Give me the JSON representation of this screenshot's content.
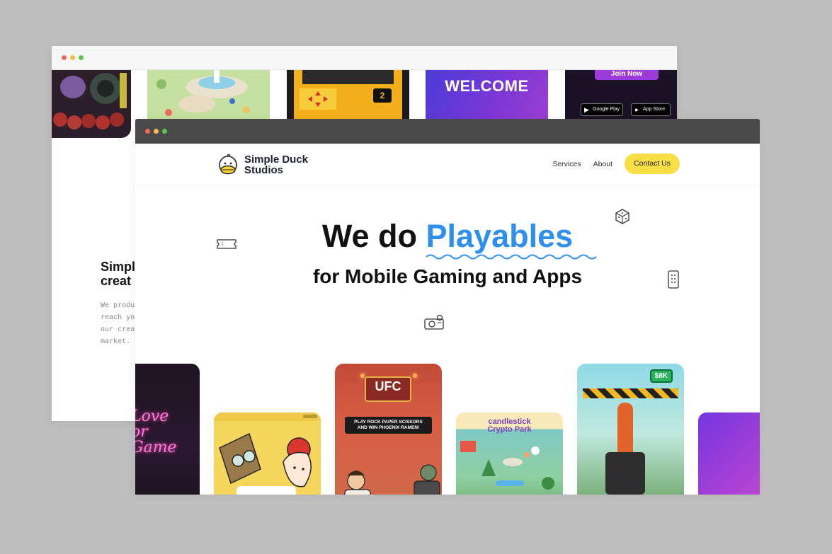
{
  "back_window": {
    "tiles": {
      "welcome_text": "WELCOME",
      "join_button": "Join Now",
      "level_badge": "2",
      "store_google": "Google Play",
      "store_apple": "App Store"
    },
    "title_partial": "Simpl\ncreat",
    "paragraph_partial": "We produ\nreach yo\nour creat\nmarket."
  },
  "front_window": {
    "brand": {
      "name": "Simple Duck\nStudios"
    },
    "nav": {
      "services": "Services",
      "about": "About",
      "contact": "Contact Us"
    },
    "hero": {
      "line1_prefix": "We do",
      "line1_highlight": "Playables",
      "line2": "for Mobile Gaming and Apps"
    },
    "cards": {
      "love_game": "Love\nor\nGame",
      "ufc_sign": "UFC",
      "ufc_banner": "PLAY ROCK PAPER SCISSORS\nAND WIN PHOENIX RAMEN!",
      "crypto_title": "candlestick\nCrypto Park",
      "cash_badge": "$8K"
    }
  },
  "colors": {
    "background": "#bebebe",
    "highlight_blue": "#2d8ff0",
    "contact_yellow": "#f7df45",
    "front_chrome": "#4a4a4a"
  },
  "icons": [
    "duck-logo-icon",
    "ticket-icon",
    "dice-icon",
    "phone-icon",
    "projector-icon"
  ]
}
